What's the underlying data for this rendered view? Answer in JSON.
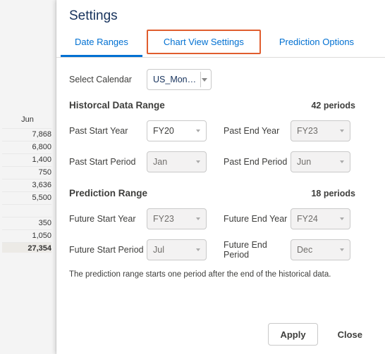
{
  "bg_table": {
    "header": "Jun",
    "rows": [
      "7,868",
      "6,800",
      "1,400",
      "750",
      "3,636",
      "5,500",
      "",
      "350",
      "1,050",
      "27,354"
    ]
  },
  "title": "Settings",
  "tabs": {
    "date_ranges": "Date Ranges",
    "chart_view": "Chart View Settings",
    "prediction_options": "Prediction Options"
  },
  "calendar": {
    "label": "Select Calendar",
    "value": "US_Mon…"
  },
  "historical": {
    "title": "Historcal Data Range",
    "periods": "42 periods",
    "past_start_year_label": "Past Start Year",
    "past_start_year": "FY20",
    "past_end_year_label": "Past End Year",
    "past_end_year": "FY23",
    "past_start_period_label": "Past Start Period",
    "past_start_period": "Jan",
    "past_end_period_label": "Past End Period",
    "past_end_period": "Jun"
  },
  "prediction": {
    "title": "Prediction Range",
    "periods": "18 periods",
    "future_start_year_label": "Future Start Year",
    "future_start_year": "FY23",
    "future_end_year_label": "Future End Year",
    "future_end_year": "FY24",
    "future_start_period_label": "Future Start Period",
    "future_start_period": "Jul",
    "future_end_period_label": "Future End Period",
    "future_end_period": "Dec"
  },
  "hint": "The prediction range starts one period after the end of the historical data.",
  "footer": {
    "apply": "Apply",
    "close": "Close"
  }
}
